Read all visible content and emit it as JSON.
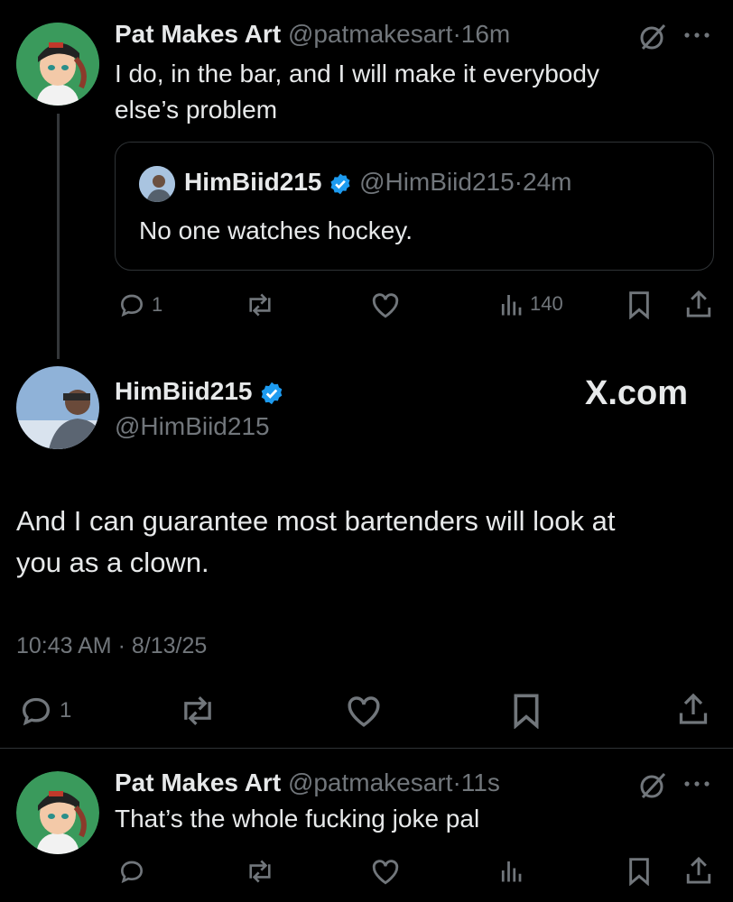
{
  "colors": {
    "background": "#000000",
    "text": "#e7e9ea",
    "muted": "#71767b",
    "verified": "#1d9bf0",
    "border": "#2f3336"
  },
  "reply1": {
    "display_name": "Pat Makes Art",
    "handle": "@patmakesart",
    "time": "16m",
    "text_line1": "I do, in the bar, and I will make it everybody",
    "text_line2": "else’s problem",
    "replies": "1",
    "views": "140",
    "icons": [
      "grok-slash-icon",
      "more-icon"
    ]
  },
  "quote": {
    "display_name": "HimBiid215",
    "handle": "@HimBiid215",
    "time": "24m",
    "text": "No one watches hockey."
  },
  "main": {
    "display_name": "HimBiid215",
    "handle": "@HimBiid215",
    "brand": "X.com",
    "text_line1": "And I can guarantee most bartenders will look at",
    "text_line2": "you as a clown.",
    "time": "10:43 AM",
    "date": "8/13/25",
    "replies": "1"
  },
  "reply2": {
    "display_name": "Pat Makes Art",
    "handle": "@patmakesart",
    "time": "11s",
    "text": "That’s the whole fucking joke pal"
  },
  "separator": "·"
}
